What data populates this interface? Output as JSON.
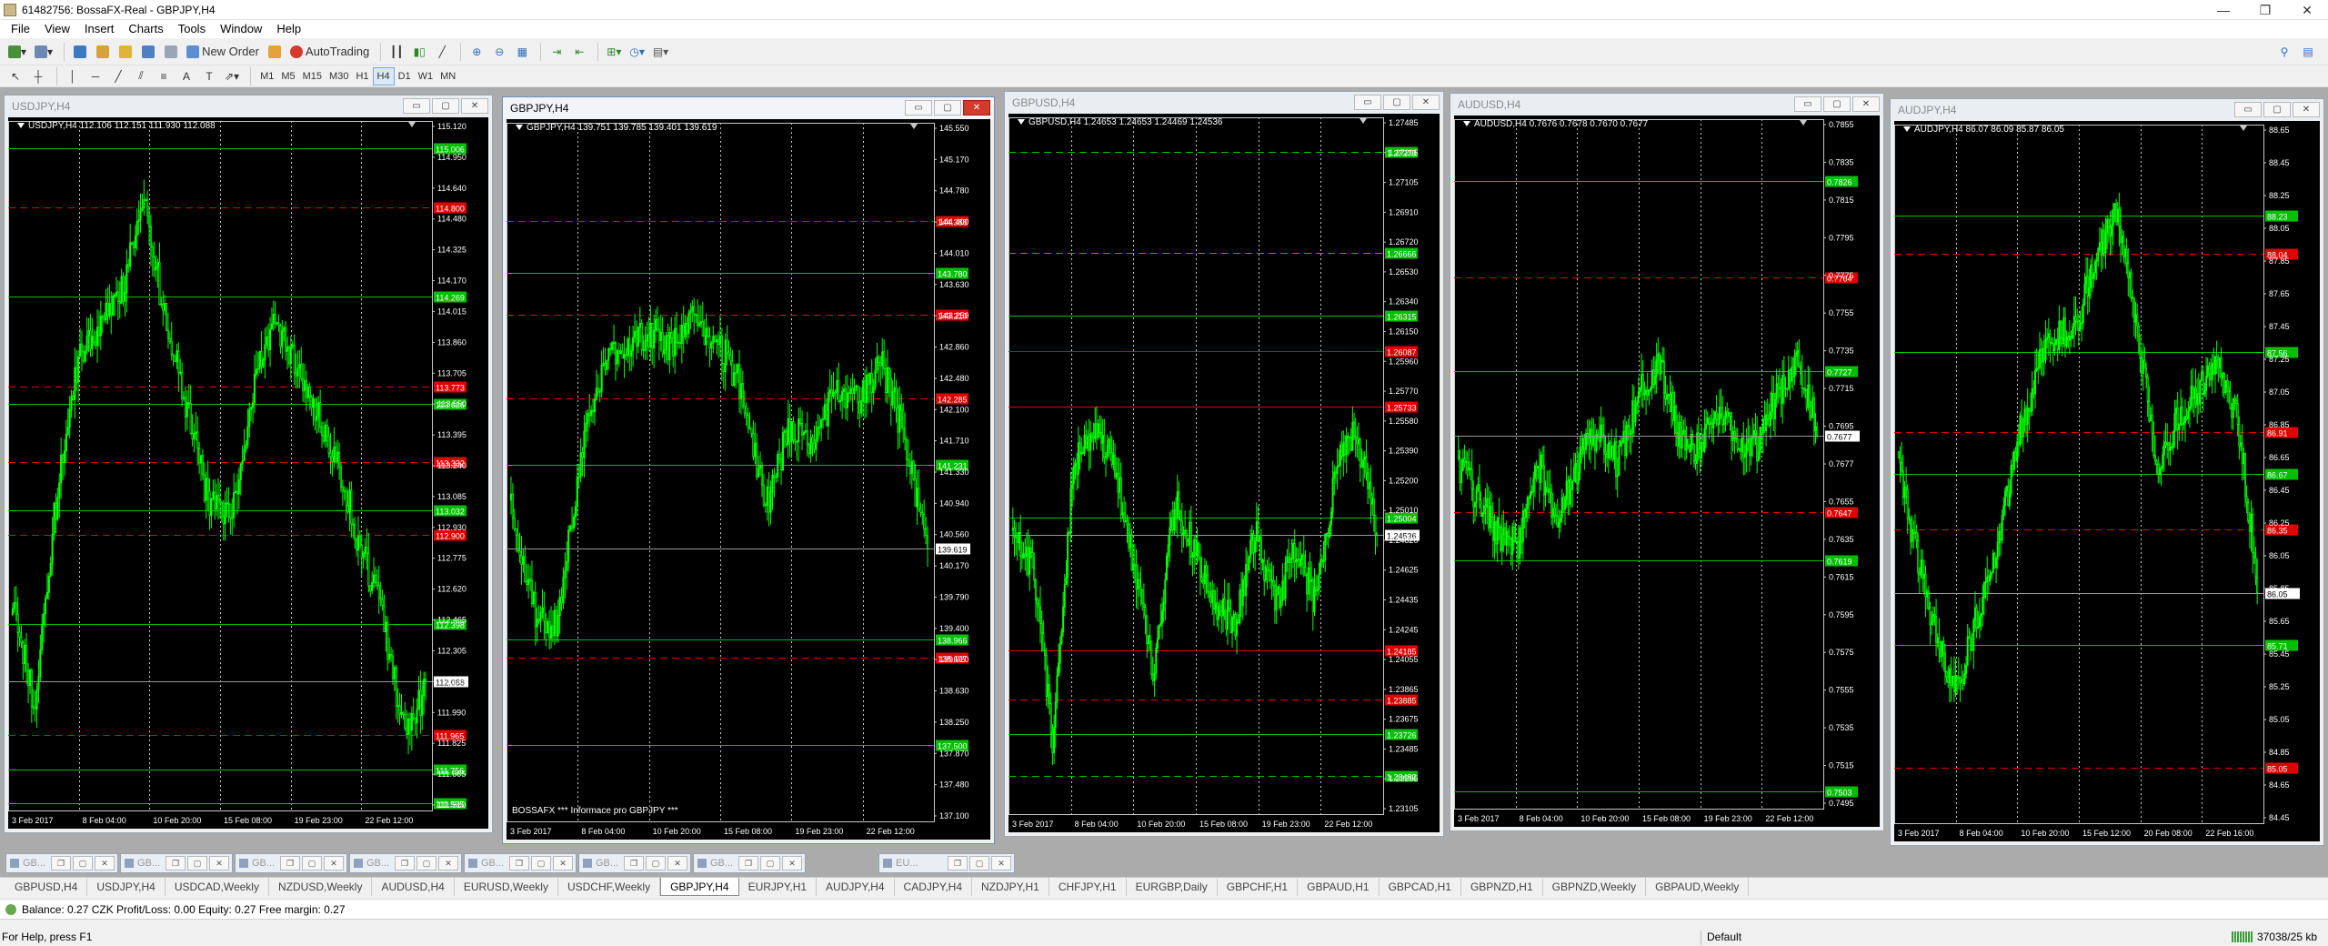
{
  "window": {
    "title": "61482756: BossaFX-Real - GBPJPY,H4",
    "controls": [
      "—",
      "❐",
      "✕"
    ]
  },
  "menu": [
    "File",
    "View",
    "Insert",
    "Charts",
    "Tools",
    "Window",
    "Help"
  ],
  "toolbar": {
    "new_order": "New Order",
    "autotrading": "AutoTrading",
    "timeframes": [
      "M1",
      "M5",
      "M15",
      "M30",
      "H1",
      "H4",
      "D1",
      "W1",
      "MN"
    ],
    "active_timeframe": "H4"
  },
  "charts": [
    {
      "title": "USDJPY,H4",
      "info": "USDJPY,H4 112.106 112.151 111.930 112.088",
      "price_labels": [
        "115.120",
        "114.950",
        "114.640",
        "114.480",
        "114.325",
        "114.170",
        "114.015",
        "113.860",
        "113.705",
        "113.550",
        "113.395",
        "113.240",
        "113.085",
        "112.930",
        "112.775",
        "112.620",
        "112.465",
        "112.305",
        "112.145",
        "111.990",
        "111.825",
        "111.665",
        "111.510"
      ],
      "current_price": "112.088",
      "time_labels": [
        "3 Feb 2017",
        "8 Feb 04:00",
        "10 Feb 20:00",
        "15 Feb 08:00",
        "19 Feb 23:00",
        "22 Feb 12:00"
      ],
      "levels": [
        {
          "y": 0.04,
          "color": "green",
          "style": "solid",
          "value": "115.006"
        },
        {
          "y": 0.125,
          "color": "red",
          "style": "dashed",
          "value": "114.800"
        },
        {
          "y": 0.255,
          "color": "green",
          "style": "solid",
          "value": "114.269"
        },
        {
          "y": 0.385,
          "color": "red",
          "style": "dashed",
          "value": "113.773"
        },
        {
          "y": 0.41,
          "color": "green",
          "style": "solid",
          "value": "113.626"
        },
        {
          "y": 0.495,
          "color": "red",
          "style": "dashed",
          "value": "113.332"
        },
        {
          "y": 0.565,
          "color": "green",
          "style": "solid",
          "value": "113.032"
        },
        {
          "y": 0.6,
          "color": "red",
          "style": "dashed",
          "value": "112.900"
        },
        {
          "y": 0.73,
          "color": "green",
          "style": "solid",
          "value": "112.398"
        },
        {
          "y": 0.89,
          "color": "red",
          "style": "dashed",
          "value": "111.965"
        },
        {
          "y": 0.94,
          "color": "green",
          "style": "solid",
          "value": "111.756"
        },
        {
          "y": 0.99,
          "color": "green",
          "style": "solid",
          "value": "111.595"
        }
      ],
      "seed": 11,
      "path": [
        0.7,
        0.85,
        0.55,
        0.35,
        0.3,
        0.25,
        0.12,
        0.28,
        0.42,
        0.55,
        0.58,
        0.4,
        0.28,
        0.35,
        0.42,
        0.5,
        0.62,
        0.72,
        0.88,
        0.83
      ]
    },
    {
      "title": "GBPJPY,H4",
      "info": "GBPJPY,H4 139.751 139.785 139.401 139.619",
      "price_labels": [
        "145.550",
        "145.170",
        "144.780",
        "144.400",
        "144.010",
        "143.630",
        "143.250",
        "142.860",
        "142.480",
        "142.100",
        "141.710",
        "141.330",
        "140.940",
        "140.560",
        "140.170",
        "139.790",
        "139.400",
        "139.020",
        "138.630",
        "138.250",
        "137.870",
        "137.480",
        "137.100"
      ],
      "current_price": "139.619",
      "time_labels": [
        "3 Feb 2017",
        "8 Feb 04:00",
        "10 Feb 20:00",
        "15 Feb 08:00",
        "19 Feb 23:00",
        "22 Feb 12:00"
      ],
      "levels": [
        {
          "y": 0.14,
          "color": "red",
          "style": "dashed",
          "value": "144.388"
        },
        {
          "y": 0.215,
          "color": "green",
          "style": "solid",
          "value": "143.780"
        },
        {
          "y": 0.275,
          "color": "red",
          "style": "dashed",
          "value": "143.210"
        },
        {
          "y": 0.395,
          "color": "red",
          "style": "dashed",
          "value": "142.285"
        },
        {
          "y": 0.49,
          "color": "green",
          "style": "solid",
          "value": "141.231"
        },
        {
          "y": 0.61,
          "color": "red",
          "style": "dashed",
          "value": "140.050"
        },
        {
          "y": 0.74,
          "color": "green",
          "style": "solid",
          "value": "138.966"
        },
        {
          "y": 0.765,
          "color": "red",
          "style": "dashed",
          "value": "138.697"
        },
        {
          "y": 0.89,
          "color": "green",
          "style": "solid",
          "value": "137.500"
        }
      ],
      "notice": "BOSSAFX *** Informace pro GBPJPY ***",
      "seed": 23,
      "path": [
        0.55,
        0.7,
        0.72,
        0.48,
        0.35,
        0.32,
        0.3,
        0.32,
        0.28,
        0.32,
        0.38,
        0.55,
        0.44,
        0.46,
        0.38,
        0.4,
        0.34,
        0.45,
        0.62
      ]
    },
    {
      "title": "GBPUSD,H4",
      "info": "GBPUSD,H4 1.24653 1.24653 1.24469 1.24536",
      "price_labels": [
        "1.27485",
        "1.27295",
        "1.27105",
        "1.26910",
        "1.26720",
        "1.26530",
        "1.26340",
        "1.26150",
        "1.25960",
        "1.25770",
        "1.25580",
        "1.25390",
        "1.25200",
        "1.25010",
        "1.24820",
        "1.24625",
        "1.24435",
        "1.24245",
        "1.24055",
        "1.23865",
        "1.23675",
        "1.23485",
        "1.23295",
        "1.23105"
      ],
      "current_price": "1.24536",
      "time_labels": [
        "3 Feb 2017",
        "8 Feb 04:00",
        "10 Feb 20:00",
        "15 Feb 08:00",
        "19 Feb 23:00",
        "22 Feb 12:00"
      ],
      "levels": [
        {
          "y": 0.05,
          "color": "green",
          "style": "dashed",
          "value": "1.27273"
        },
        {
          "y": 0.195,
          "color": "green",
          "style": "dashed",
          "value": "1.26666"
        },
        {
          "y": 0.285,
          "color": "green",
          "style": "solid",
          "value": "1.26315"
        },
        {
          "y": 0.335,
          "color": "red",
          "style": "solid",
          "value": "1.26087"
        },
        {
          "y": 0.415,
          "color": "red",
          "style": "solid",
          "value": "1.25733"
        },
        {
          "y": 0.575,
          "color": "green",
          "style": "solid",
          "value": "1.25004"
        },
        {
          "y": 0.765,
          "color": "red",
          "style": "solid",
          "value": "1.24185"
        },
        {
          "y": 0.835,
          "color": "red",
          "style": "dashed",
          "value": "1.23885"
        },
        {
          "y": 0.885,
          "color": "green",
          "style": "solid",
          "value": "1.23726"
        },
        {
          "y": 0.945,
          "color": "green",
          "style": "dashed",
          "value": "1.23482"
        }
      ],
      "seed": 37,
      "path": [
        0.58,
        0.65,
        0.9,
        0.5,
        0.45,
        0.5,
        0.65,
        0.8,
        0.55,
        0.62,
        0.7,
        0.72,
        0.6,
        0.7,
        0.62,
        0.7,
        0.5,
        0.45,
        0.6
      ]
    },
    {
      "title": "AUDUSD,H4",
      "info": "AUDUSD,H4 0.7676 0.7678 0.7670 0.7677",
      "price_labels": [
        "0.7855",
        "0.7835",
        "0.7815",
        "0.7795",
        "0.7775",
        "0.7755",
        "0.7735",
        "0.7715",
        "0.7695",
        "0.7677",
        "0.7655",
        "0.7635",
        "0.7615",
        "0.7595",
        "0.7575",
        "0.7555",
        "0.7535",
        "0.7515",
        "0.7495"
      ],
      "current_price": "0.7677",
      "time_labels": [
        "3 Feb 2017",
        "8 Feb 04:00",
        "10 Feb 20:00",
        "15 Feb 08:00",
        "19 Feb 23:00",
        "22 Feb 12:00"
      ],
      "levels": [
        {
          "y": 0.09,
          "color": "green",
          "style": "solid",
          "value": "0.7826"
        },
        {
          "y": 0.23,
          "color": "red",
          "style": "dashed",
          "value": "0.7764"
        },
        {
          "y": 0.365,
          "color": "green",
          "style": "solid",
          "value": "0.7727"
        },
        {
          "y": 0.57,
          "color": "red",
          "style": "dashed",
          "value": "0.7647"
        },
        {
          "y": 0.64,
          "color": "green",
          "style": "solid",
          "value": "0.7619"
        },
        {
          "y": 0.975,
          "color": "green",
          "style": "solid",
          "value": "0.7503"
        }
      ],
      "seed": 53,
      "path": [
        0.5,
        0.55,
        0.6,
        0.62,
        0.5,
        0.58,
        0.5,
        0.45,
        0.5,
        0.4,
        0.35,
        0.45,
        0.48,
        0.42,
        0.46,
        0.48,
        0.4,
        0.35,
        0.45
      ]
    },
    {
      "title": "AUDJPY,H4",
      "info": "AUDJPY,H4 86.07 86.09 85.87 86.05",
      "price_labels": [
        "88.65",
        "88.45",
        "88.25",
        "88.05",
        "87.85",
        "87.65",
        "87.45",
        "87.25",
        "87.05",
        "86.85",
        "86.65",
        "86.45",
        "86.25",
        "86.05",
        "85.85",
        "85.65",
        "85.45",
        "85.25",
        "85.05",
        "84.85",
        "84.65",
        "84.45"
      ],
      "current_price": "86.05",
      "time_labels": [
        "3 Feb 2017",
        "8 Feb 04:00",
        "10 Feb 20:00",
        "15 Feb 12:00",
        "20 Feb 08:00",
        "22 Feb 16:00"
      ],
      "levels": [
        {
          "y": 0.13,
          "color": "green",
          "style": "solid",
          "value": "88.23"
        },
        {
          "y": 0.185,
          "color": "red",
          "style": "dashed",
          "value": "88.04"
        },
        {
          "y": 0.325,
          "color": "green",
          "style": "solid",
          "value": "87.56"
        },
        {
          "y": 0.44,
          "color": "red",
          "style": "dashed",
          "value": "86.91"
        },
        {
          "y": 0.5,
          "color": "green",
          "style": "solid",
          "value": "86.67"
        },
        {
          "y": 0.58,
          "color": "red",
          "style": "dashed",
          "value": "86.35"
        },
        {
          "y": 0.745,
          "color": "green",
          "style": "solid",
          "value": "85.71"
        },
        {
          "y": 0.92,
          "color": "red",
          "style": "dashed",
          "value": "85.05"
        }
      ],
      "seed": 71,
      "path": [
        0.5,
        0.62,
        0.75,
        0.8,
        0.7,
        0.6,
        0.45,
        0.35,
        0.3,
        0.28,
        0.18,
        0.12,
        0.3,
        0.5,
        0.42,
        0.38,
        0.35,
        0.42,
        0.65
      ]
    }
  ],
  "minimized": [
    "GB...",
    "GB...",
    "GB...",
    "GB...",
    "GB...",
    "GB...",
    "GB...",
    "EU..."
  ],
  "tabs": [
    "GBPUSD,H4",
    "USDJPY,H4",
    "USDCAD,Weekly",
    "NZDUSD,Weekly",
    "AUDUSD,H4",
    "EURUSD,Weekly",
    "USDCHF,Weekly",
    "GBPJPY,H4",
    "EURJPY,H1",
    "AUDJPY,H4",
    "CADJPY,H4",
    "NZDJPY,H1",
    "CHFJPY,H1",
    "EURGBP,Daily",
    "GBPCHF,H1",
    "GBPAUD,H1",
    "GBPCAD,H1",
    "GBPNZD,H1",
    "GBPNZD,Weekly",
    "GBPAUD,Weekly"
  ],
  "active_tab": "GBPJPY,H4",
  "balance": "Balance: 0.27 CZK  Profit/Loss: 0.00  Equity: 0.27  Free margin: 0.27",
  "status": {
    "help": "For Help, press F1",
    "profile": "Default",
    "traffic": "37038/25 kb"
  },
  "colors": {
    "candle": "#00ff00",
    "chart_bg": "#000000",
    "grid": "#c8c8c8",
    "level_green": "#00c000",
    "level_red": "#e00000"
  }
}
